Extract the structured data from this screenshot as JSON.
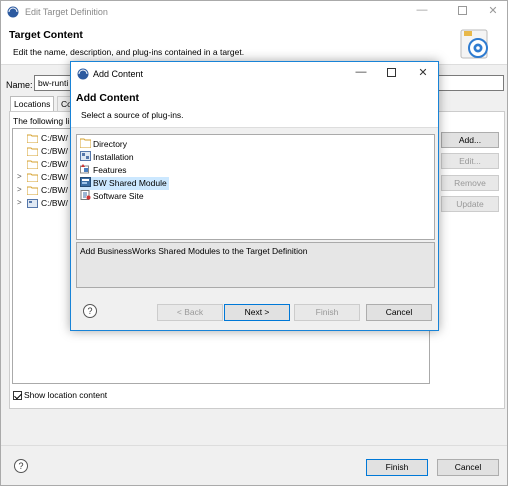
{
  "outer_window": {
    "title": "Edit Target Definition",
    "header_title": "Target Content",
    "header_desc": "Edit the name, description, and plug-ins contained in a target.",
    "name_label": "Name:",
    "name_value": "bw-runti",
    "tabs": [
      {
        "label": "Locations"
      },
      {
        "label": "Co"
      }
    ],
    "panel_intro": "The following li",
    "locations": [
      {
        "label": "C:/BW/",
        "expand": ""
      },
      {
        "label": "C:/BW/",
        "expand": ""
      },
      {
        "label": "C:/BW/",
        "expand": ""
      },
      {
        "label": "C:/BW/",
        "expand": ">"
      },
      {
        "label": "C:/BW/",
        "expand": ">"
      },
      {
        "label": "C:/BW/",
        "expand": ">"
      }
    ],
    "side_buttons": {
      "add": "Add...",
      "edit": "Edit...",
      "remove": "Remove",
      "update": "Update"
    },
    "show_location_content": "Show location content",
    "help": "?",
    "finish": "Finish",
    "cancel": "Cancel"
  },
  "modal": {
    "title": "Add Content",
    "header_title": "Add Content",
    "header_desc": "Select a source of plug-ins.",
    "sources": [
      {
        "label": "Directory",
        "icon": "folder-icon"
      },
      {
        "label": "Installation",
        "icon": "installation-icon"
      },
      {
        "label": "Features",
        "icon": "features-icon"
      },
      {
        "label": "BW Shared Module",
        "icon": "bw-module-icon"
      },
      {
        "label": "Software Site",
        "icon": "software-site-icon"
      }
    ],
    "selected_source": "BW Shared Module",
    "description": "Add BusinessWorks Shared Modules to the Target Definition",
    "help": "?",
    "back": "< Back",
    "next": "Next >",
    "finish": "Finish",
    "cancel": "Cancel"
  },
  "colors": {
    "accent": "#1883d7",
    "selection": "#cce8ff",
    "folder": "#e8b84a"
  }
}
